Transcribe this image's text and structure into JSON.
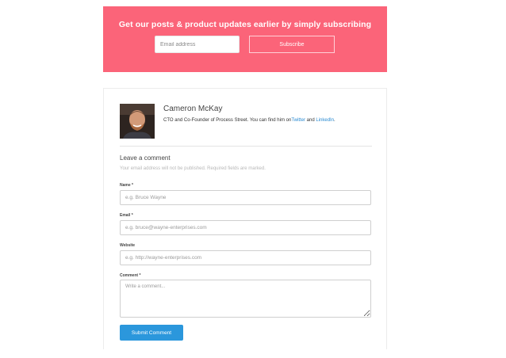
{
  "banner": {
    "heading": "Get our posts & product updates earlier by simply subscribing",
    "email_placeholder": "Email address",
    "subscribe_label": "Subscribe",
    "background_color": "#fb6479"
  },
  "author": {
    "name": "Cameron McKay",
    "bio_prefix": "CTO and Co-Founder of Process Street. You can find him on",
    "twitter_label": "Twitter",
    "bio_and": " and ",
    "linkedin_label": "LinkedIn",
    "bio_suffix": ".",
    "link_color": "#2a8ad1"
  },
  "comment_form": {
    "heading": "Leave a comment",
    "notice": "Your email address will not be published. Required fields are marked.",
    "name_label": "Name *",
    "name_placeholder": "e.g. Bruce Wayne",
    "email_label": "Email *",
    "email_placeholder": "e.g. bruce@wayne-enterprises.com",
    "website_label": "Website",
    "website_placeholder": "e.g. http://wayne-enterprises.com",
    "comment_label": "Comment *",
    "comment_placeholder": "Write a comment...",
    "submit_label": "Submit Comment",
    "submit_color": "#2b97dc"
  }
}
